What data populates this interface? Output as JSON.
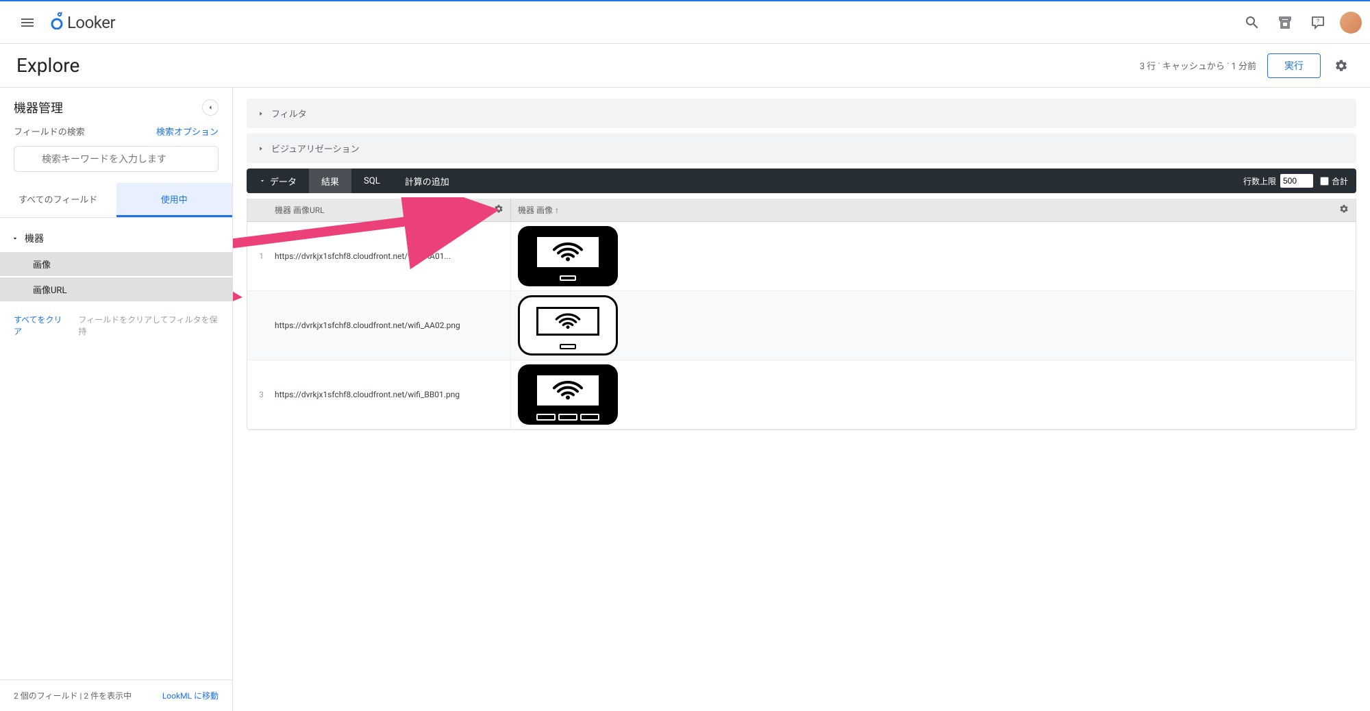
{
  "app": {
    "name": "Looker"
  },
  "explore": {
    "title": "Explore",
    "cache_info": "3 行 ˙ キャッシュから ˙ 1 分前",
    "run_label": "実行"
  },
  "sidebar": {
    "title": "機器管理",
    "search_label": "フィールドの検索",
    "search_options_label": "検索オプション",
    "search_placeholder": "検索キーワードを入力します",
    "tabs": {
      "all_fields": "すべてのフィールド",
      "in_use": "使用中"
    },
    "group": {
      "name": "機器",
      "fields": [
        {
          "label": "画像",
          "selected": true
        },
        {
          "label": "画像URL",
          "selected": true
        }
      ]
    },
    "clear_all": "すべてをクリア",
    "clear_keep_filters": "フィールドをクリアしてフィルタを保持",
    "footer_status": "2 個のフィールド | 2 件を表示中",
    "lookml_link": "LookML に移動"
  },
  "panels": {
    "filter": "フィルタ",
    "visualization": "ビジュアリゼーション"
  },
  "data_bar": {
    "data_label": "データ",
    "results": "結果",
    "sql": "SQL",
    "add_calc": "計算の追加",
    "row_limit_label": "行数上限",
    "row_limit_value": "500",
    "total_label": "合計"
  },
  "table": {
    "headers": {
      "url": "機器 画像URL",
      "image": "機器 画像 ↑"
    },
    "rows": [
      {
        "n": "1",
        "url": "https://dvrkjx1sfchf8.cloudfront.net/wifi_AA01...",
        "device": "dark1"
      },
      {
        "n": "",
        "url": "https://dvrkjx1sfchf8.cloudfront.net/wifi_AA02.png",
        "device": "light"
      },
      {
        "n": "3",
        "url": "https://dvrkjx1sfchf8.cloudfront.net/wifi_BB01.png",
        "device": "dark3"
      }
    ]
  }
}
